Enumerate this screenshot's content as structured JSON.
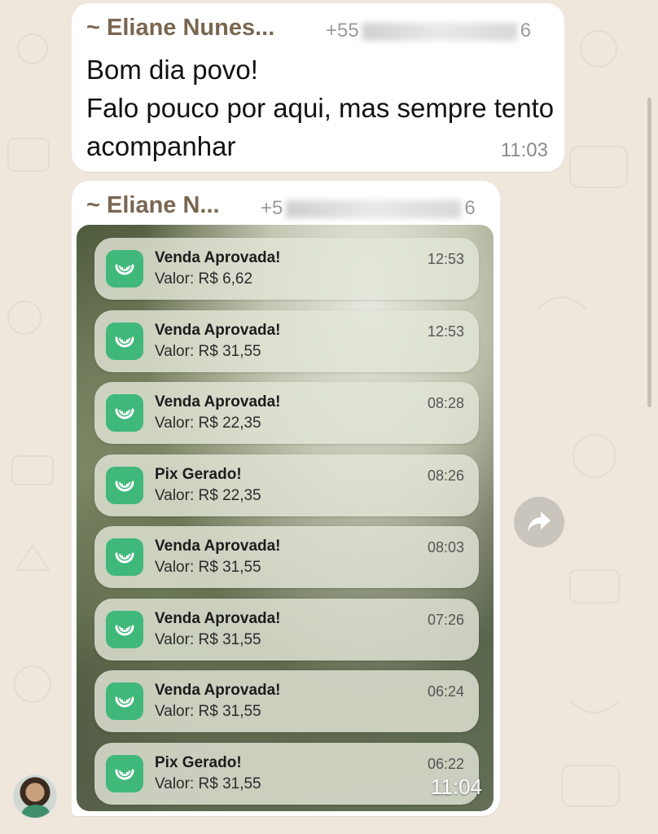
{
  "messages": [
    {
      "sender": "~ Eliane Nunes...",
      "phone_prefix": "+55",
      "phone_suffix": "6",
      "text": "Bom dia povo!\nFalo pouco por aqui, mas sempre tento acompanhar",
      "time": "11:03"
    },
    {
      "sender": "~ Eliane N...",
      "phone_prefix": "+5",
      "phone_suffix": "6",
      "time": "11:04",
      "notifications": [
        {
          "title": "Venda Aprovada!",
          "value": "Valor: R$ 6,62",
          "time": "12:53"
        },
        {
          "title": "Venda Aprovada!",
          "value": "Valor: R$ 31,55",
          "time": "12:53"
        },
        {
          "title": "Venda Aprovada!",
          "value": "Valor: R$ 22,35",
          "time": "08:28"
        },
        {
          "title": "Pix Gerado!",
          "value": "Valor: R$ 22,35",
          "time": "08:26"
        },
        {
          "title": "Venda Aprovada!",
          "value": "Valor: R$ 31,55",
          "time": "08:03"
        },
        {
          "title": "Venda Aprovada!",
          "value": "Valor: R$ 31,55",
          "time": "07:26"
        },
        {
          "title": "Venda Aprovada!",
          "value": "Valor: R$ 31,55",
          "time": "06:24"
        },
        {
          "title": "Pix Gerado!",
          "value": "Valor: R$ 31,55",
          "time": "06:22"
        }
      ]
    }
  ],
  "icons": {
    "notification_app": "watermelon-icon",
    "forward": "forward-arrow-icon",
    "avatar": "user-avatar"
  },
  "colors": {
    "sender_name": "#7a6650",
    "app_icon": "#3fb87a",
    "chat_background": "#efe7dc"
  }
}
